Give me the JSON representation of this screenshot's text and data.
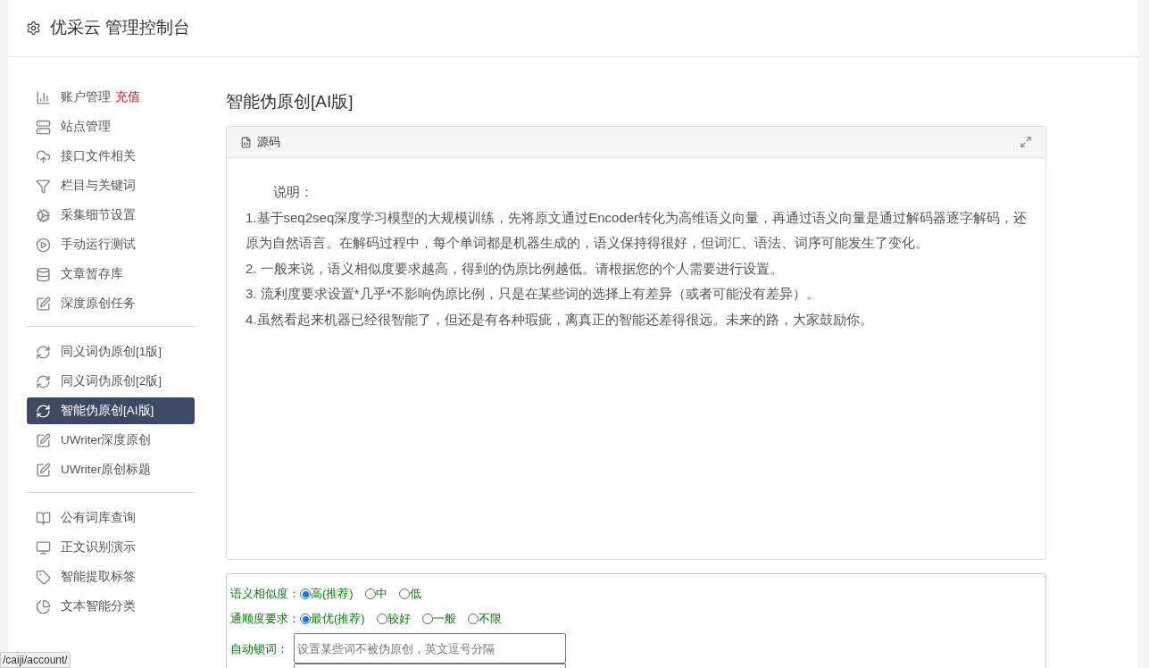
{
  "header": {
    "title": "优采云 管理控制台"
  },
  "sidebar": {
    "groups": [
      {
        "items": [
          {
            "label": "账户管理",
            "badge": "充值",
            "selected": false
          },
          {
            "label": "站点管理",
            "selected": false
          },
          {
            "label": "接口文件相关",
            "selected": false
          },
          {
            "label": "栏目与关键词",
            "selected": false
          },
          {
            "label": "采集细节设置",
            "selected": false
          },
          {
            "label": "手动运行测试",
            "selected": false
          },
          {
            "label": "文章暂存库",
            "selected": false
          },
          {
            "label": "深度原创任务",
            "selected": false
          }
        ]
      },
      {
        "items": [
          {
            "label": "同义词伪原创[1版]",
            "selected": false
          },
          {
            "label": "同义词伪原创[2版]",
            "selected": false
          },
          {
            "label": "智能伪原创[AI版]",
            "selected": true
          },
          {
            "label": "UWriter深度原创",
            "selected": false
          },
          {
            "label": "UWriter原创标题",
            "selected": false
          }
        ]
      },
      {
        "items": [
          {
            "label": "公有词库查询",
            "selected": false
          },
          {
            "label": "正文识别演示",
            "selected": false
          },
          {
            "label": "智能提取标签",
            "selected": false
          },
          {
            "label": "文本智能分类",
            "selected": false
          }
        ]
      }
    ]
  },
  "page_title": "智能伪原创[AI版]",
  "source_card": {
    "tab": "源码",
    "paragraphs": [
      "说明：",
      "1.基于seq2seq深度学习模型的大规模训练，先将原文通过Encoder转化为高维语义向量，再通过语义向量是通过解码器逐字解码，还原为自然语言。在解码过程中，每个单词都是机器生成的，语义保持得很好，但词汇、语法、词序可能发生了变化。",
      "2. 一般来说，语义相似度要求越高，得到的伪原比例越低。请根据您的个人需要进行设置。",
      "3. 流利度要求设置*几乎*不影响伪原比例，只是在某些词的选择上有差异（或者可能没有差异）。",
      "4.虽然看起来机器已经很智能了，但还是有各种瑕疵，离真正的智能还差得很远。未来的路，大家鼓励你。"
    ]
  },
  "form": {
    "rows": [
      {
        "kind": "radio",
        "label": "语义相似度：",
        "options": [
          {
            "label": "高(推荐)",
            "selected": true
          },
          {
            "label": "中",
            "selected": false
          },
          {
            "label": "低",
            "selected": false
          }
        ]
      },
      {
        "kind": "radio",
        "label": "通顺度要求：",
        "options": [
          {
            "label": "最优(推荐)",
            "selected": true
          },
          {
            "label": "较好",
            "selected": false
          },
          {
            "label": "一般",
            "selected": false
          },
          {
            "label": "不限",
            "selected": false
          }
        ]
      },
      {
        "kind": "input",
        "label": "自动锁词：",
        "placeholder": "设置某些词不被伪原创，英文逗号分隔"
      },
      {
        "kind": "textarea"
      }
    ]
  },
  "status_bar": {
    "url": "/caiji/account/"
  }
}
